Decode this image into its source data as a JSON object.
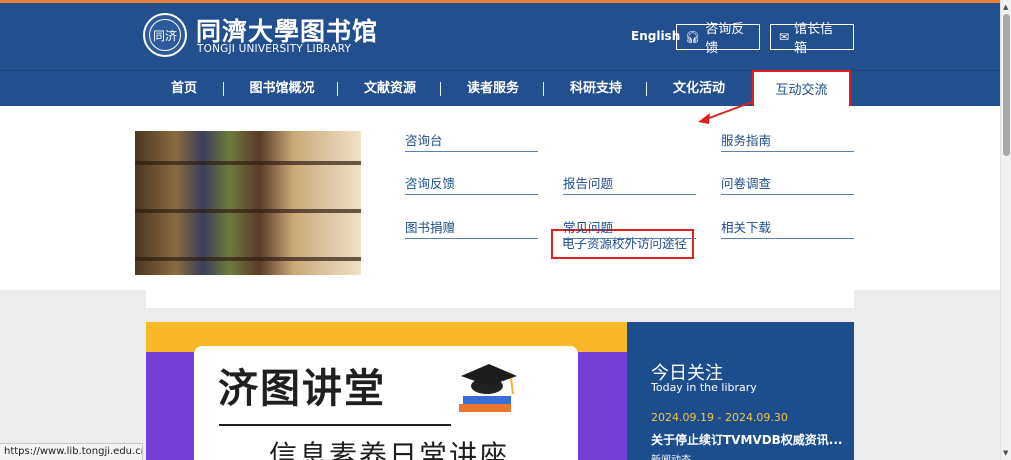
{
  "header": {
    "logo_cn": "同濟大學图书馆",
    "logo_en": "TONGJI UNIVERSITY LIBRARY",
    "seal_text": "同济",
    "lang_link": "English",
    "consult_label": "咨询反馈",
    "mailbox_label": "馆长信箱",
    "icons": {
      "consult": "headset-icon",
      "mail": "envelope-icon"
    }
  },
  "nav": {
    "items": [
      "首页",
      "图书馆概况",
      "文献资源",
      "读者服务",
      "科研支持",
      "文化活动",
      "互动交流"
    ],
    "active": "互动交流"
  },
  "dropdown": {
    "columns": [
      [
        "咨询台",
        "咨询反馈",
        "图书捐赠"
      ],
      [
        "电子资源校外访问途径",
        "报告问题",
        "常见问题"
      ],
      [
        "服务指南",
        "问卷调查",
        "相关下载"
      ]
    ],
    "highlighted": "电子资源校外访问途径"
  },
  "banner": {
    "title": "济图讲堂",
    "subtitle": "信息素养日常讲座"
  },
  "today": {
    "heading": "今日关注",
    "heading_en": "Today in the library",
    "date_range": "2024.09.19 - 2024.09.30",
    "news_title": "关于停止续订TVMVDB权威资讯...",
    "tag": "新闻动态"
  },
  "statusbar": {
    "url": "https://www.lib.tongji.edu.cn/#"
  },
  "colors": {
    "brand_blue": "#22508f",
    "highlight_red": "#e02020",
    "accent_yellow": "#f3c540"
  }
}
